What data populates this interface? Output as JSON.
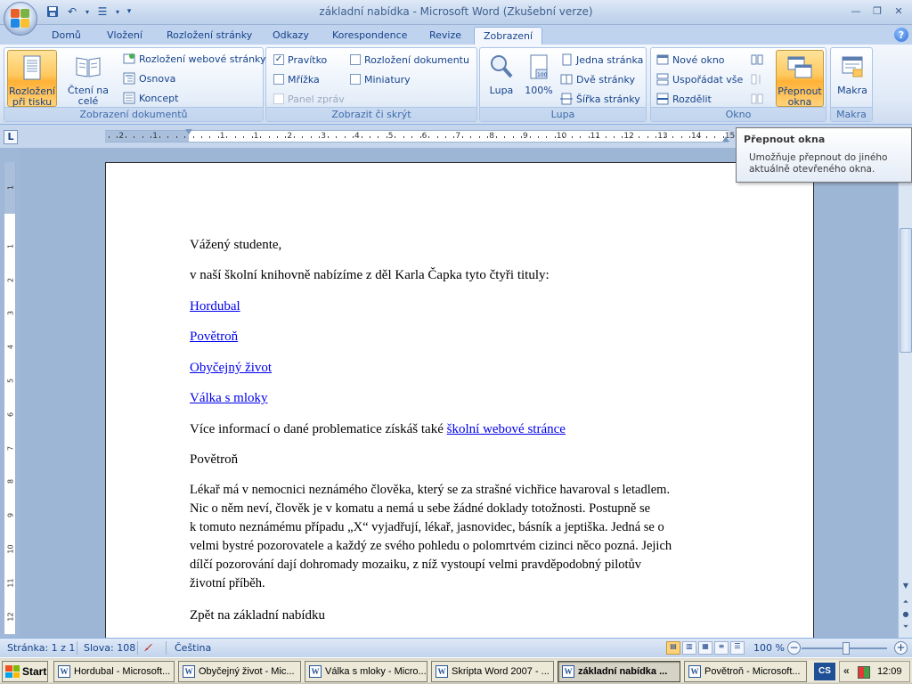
{
  "window": {
    "title": "základní nabídka - Microsoft Word (Zkušební verze)"
  },
  "tabs": [
    "Domů",
    "Vložení",
    "Rozložení stránky",
    "Odkazy",
    "Korespondence",
    "Revize",
    "Zobrazení"
  ],
  "active_tab": "Zobrazení",
  "ribbon": {
    "views": {
      "label": "Zobrazení dokumentů",
      "print_layout": "Rozložení\npři tisku",
      "full_screen": "Čtení na celé\nobrazovce",
      "web_layout": "Rozložení webové stránky",
      "outline": "Osnova",
      "draft": "Koncept"
    },
    "show_hide": {
      "label": "Zobrazit či skrýt",
      "ruler": "Pravítko",
      "gridlines": "Mřížka",
      "message_bar": "Panel zpráv",
      "doc_map": "Rozložení dokumentu",
      "thumbnails": "Miniatury"
    },
    "zoom": {
      "label": "Lupa",
      "zoom": "Lupa",
      "hundred": "100%",
      "one_page": "Jedna stránka",
      "two_pages": "Dvě stránky",
      "page_width": "Šířka stránky"
    },
    "window": {
      "label": "Okno",
      "new_window": "Nové okno",
      "arrange_all": "Uspořádat vše",
      "split": "Rozdělit",
      "switch_windows": "Přepnout\nokna"
    },
    "macros": {
      "label": "Makra",
      "macros": "Makra"
    }
  },
  "ruler_numbers": [
    "2",
    "1",
    "1",
    "1",
    "2",
    "3",
    "4",
    "5",
    "6",
    "7",
    "8",
    "9",
    "10",
    "11",
    "12",
    "13",
    "14",
    "15"
  ],
  "vruler_numbers": [
    "1",
    "1",
    "2",
    "3",
    "4",
    "5",
    "6",
    "7",
    "8",
    "9",
    "10",
    "11",
    "12"
  ],
  "tooltip": {
    "title": "Přepnout okna",
    "body": "Umožňuje přepnout do jiného aktuálně otevřeného okna."
  },
  "document": {
    "greeting": "Vážený studente,",
    "intro": "v naší školní knihovně nabízíme z děl Karla Čapka tyto čtyři tituly:",
    "links": [
      "Hordubal",
      "Povětroň",
      "Obyčejný život",
      "Válka s mloky"
    ],
    "more_info_prefix": "Více informací o dané problematice získáš také ",
    "more_info_link": "školní webové stránce",
    "section_title": "Povětroň",
    "body_lines": [
      "Lékař má v nemocnici neznámého člověka, který se za strašné vichřice havaroval s letadlem.",
      "Nic o něm neví, člověk je v komatu a nemá u sebe žádné doklady totožnosti. Postupně se",
      "k tomuto neznámému případu „X“ vyjadřují, lékař, jasnovidec, básník a jeptiška. Jedná se o",
      "velmi bystré pozorovatele a každý ze svého pohledu o polomrtvém cizinci něco pozná. Jejich",
      "dílčí pozorování dají dohromady mozaiku, z níž vystoupí velmi pravděpodobný pilotův",
      "životní příběh."
    ],
    "back_link": "Zpět na základní nabídku"
  },
  "status": {
    "page": "Stránka: 1 z 1",
    "words": "Slova: 108",
    "language": "Čeština",
    "zoom": "100 %"
  },
  "taskbar": {
    "start": "Start",
    "tasks": [
      "Hordubal - Microsoft...",
      "Obyčejný život - Mic...",
      "Válka s mloky - Micro...",
      "Skripta Word 2007 - ...",
      "základní nabídka ...",
      "Povětroň - Microsoft..."
    ],
    "lang": "CS",
    "clock": "12:09"
  },
  "colors": {
    "accent": "#15428b",
    "link": "#0000ee",
    "active_button": "#ffc85e"
  }
}
